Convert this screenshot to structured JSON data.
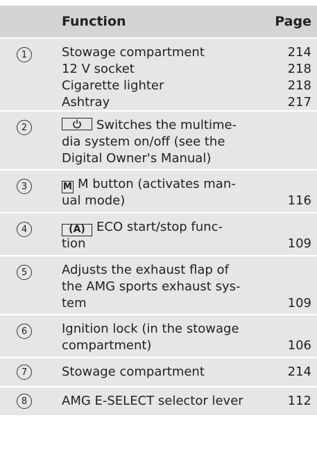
{
  "header": {
    "function": "Function",
    "page": "Page"
  },
  "rows": [
    {
      "num": "1",
      "lines": [
        {
          "text": "Stowage compartment",
          "page": "214"
        },
        {
          "text": "12 V socket",
          "page": "218"
        },
        {
          "text": "Cigarette lighter",
          "page": "218"
        },
        {
          "text": "Ashtray",
          "page": "217"
        }
      ]
    },
    {
      "num": "2",
      "lines": [
        {
          "text": "Switches the multime-",
          "page": ""
        },
        {
          "text": "dia system on/off (see the",
          "page": ""
        },
        {
          "text": "Digital Owner's Manual)",
          "page": ""
        }
      ],
      "icon": "power-button-icon"
    },
    {
      "num": "3",
      "lines": [
        {
          "text": "M button (activates man-",
          "page": ""
        },
        {
          "text": "ual mode)",
          "page": "116"
        }
      ],
      "key": "M"
    },
    {
      "num": "4",
      "lines": [
        {
          "text": "ECO start/stop func-",
          "page": ""
        },
        {
          "text": "tion",
          "page": "109"
        }
      ],
      "key": "A"
    },
    {
      "num": "5",
      "lines": [
        {
          "text": "Adjusts the exhaust flap of",
          "page": ""
        },
        {
          "text": "the AMG sports exhaust sys-",
          "page": ""
        },
        {
          "text": "tem",
          "page": "109"
        }
      ]
    },
    {
      "num": "6",
      "lines": [
        {
          "text": "Ignition lock (in the stowage",
          "page": ""
        },
        {
          "text": "compartment)",
          "page": "106"
        }
      ]
    },
    {
      "num": "7",
      "lines": [
        {
          "text": "Stowage compartment",
          "page": "214"
        }
      ]
    },
    {
      "num": "8",
      "lines": [
        {
          "text": "AMG E-SELECT selector lever",
          "page": "112"
        }
      ]
    }
  ]
}
